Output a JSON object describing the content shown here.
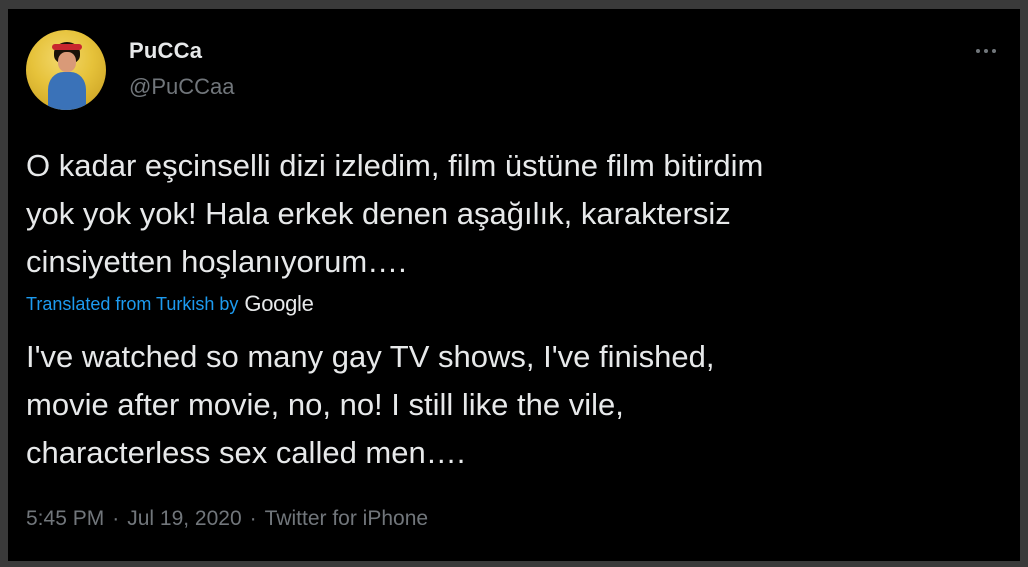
{
  "tweet": {
    "author": {
      "display_name": "PuCCa",
      "handle": "@PuCCaa",
      "avatar_icon": "profile-photo"
    },
    "more_icon": "more-horizontal-icon",
    "text": "O kadar eşcinselli dizi izledim, film üstüne film bitirdim\nyok yok yok! Hala erkek denen aşağılık, karaktersiz\ncinsiyetten hoşlanıyorum….",
    "translation": {
      "label": "Translated from Turkish by",
      "provider": "Google",
      "text": "I've watched so many gay TV shows, I've finished,\nmovie after movie, no, no! I still like the vile,\ncharacterless sex called men…."
    },
    "meta": {
      "time": "5:45 PM",
      "separator": "·",
      "date": "Jul 19, 2020",
      "source": "Twitter for iPhone"
    }
  },
  "colors": {
    "background": "#000000",
    "primary_text": "#e7e9ea",
    "secondary_text": "#71767b",
    "link": "#1d9bf0"
  }
}
